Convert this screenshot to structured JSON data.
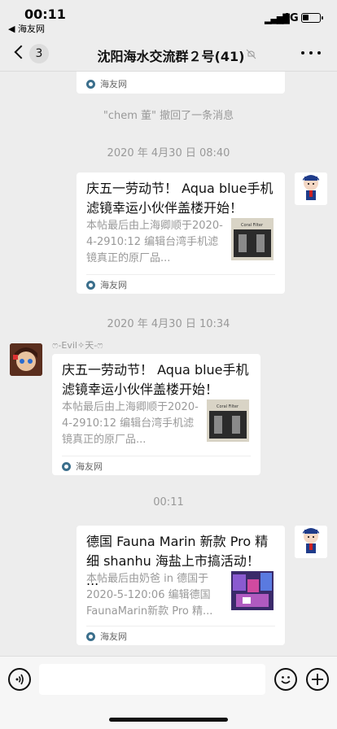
{
  "status_bar": {
    "time": "00:11",
    "back_app": "◀ 海友网",
    "network": "4G"
  },
  "nav": {
    "unread_count": "3",
    "title": "沈阳海水交流群２号(41)"
  },
  "messages": {
    "partial_card": {
      "source": "海友网"
    },
    "recall_notice": "\"chem 董\" 撤回了一条消息",
    "timestamp_1": "2020 年 4月30 日 08:40",
    "card_1": {
      "title": "庆五一劳动节！ Aqua blue手机滤镜幸运小伙伴盖楼开始！",
      "desc": "本帖最后由上海卿顺于2020-4-2910:12 编辑台湾手机滤镜真正的原厂品...",
      "source": "海友网"
    },
    "timestamp_2": "2020 年 4月30 日 10:34",
    "sender_name": "ෆ-Evil✧天-ෆ",
    "card_2": {
      "title": "庆五一劳动节！ Aqua blue手机滤镜幸运小伙伴盖楼开始！",
      "desc": "本帖最后由上海卿顺于2020-4-2910:12 编辑台湾手机滤镜真正的原厂品...",
      "source": "海友网"
    },
    "timestamp_3": "00:11",
    "card_3": {
      "title": "德国 Fauna Marin 新款 Pro 精细 shanhu 海盐上市搞活动！ ...",
      "desc": "本帖最后由奶爸 in 德国于2020-5-120:06 编辑德国FaunaMarin新款 Pro 精...",
      "source": "海友网"
    }
  },
  "thumb_label": "Coral Filter",
  "icons": [
    "back-chevron-icon",
    "mute-icon",
    "more-icon",
    "voice-icon",
    "emoji-icon",
    "add-icon"
  ]
}
